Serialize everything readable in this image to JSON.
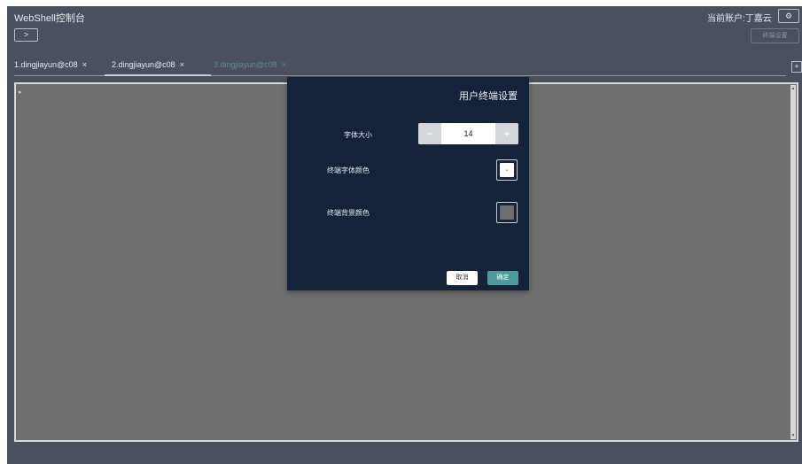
{
  "app": {
    "title": "WebShell控制台",
    "expand_label": ">"
  },
  "account": {
    "label": "当前账户:丁嘉云",
    "button_label": "⚙",
    "settings_button_label": "终端设置"
  },
  "tabs": [
    {
      "label": "1.dingjiayun@c08",
      "close": "×"
    },
    {
      "label": "2.dingjiayun@c08",
      "close": "×"
    },
    {
      "label": "3.dingjiayun@c08",
      "close": "×"
    }
  ],
  "add_tab_label": "+",
  "terminal": {
    "caret": "▸"
  },
  "dialog": {
    "title": "用户终端设置",
    "font_size_label": "字体大小",
    "font_size_value": "14",
    "minus": "−",
    "plus": "+",
    "font_color_label": "终端字体颜色",
    "font_color_value": "#ffffff",
    "font_color_marker": "⌄",
    "bg_color_label": "终端背景颜色",
    "bg_color_value": "#6f6f6f",
    "cancel_label": "取消",
    "ok_label": "确定"
  },
  "colors": {
    "accent": "#4f9a9a",
    "dialog_bg": "#14223a",
    "app_bg": "#4a505d"
  }
}
